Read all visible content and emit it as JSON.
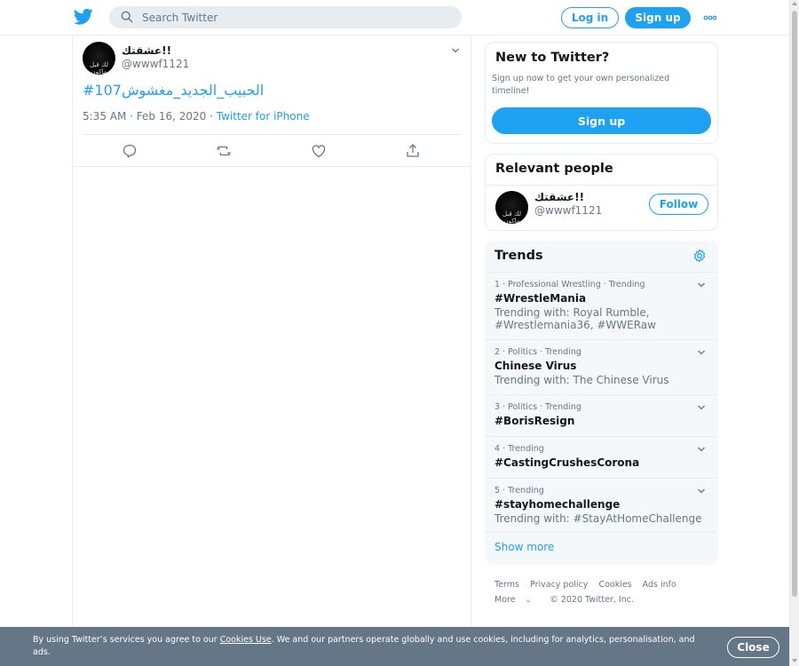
{
  "header": {
    "logo_icon": "twitter-bird-icon",
    "search_placeholder": "Search Twitter",
    "login_label": "Log in",
    "signup_label": "Sign up",
    "more_icon": "more-dots-icon"
  },
  "tweet": {
    "display_name": "عشقتك!!",
    "handle": "@wwwf1121",
    "avatar_text": "لك قبل ماكون",
    "text": "#الحبيب_الجديد_مغشوش107",
    "time": "5:35 AM · Feb 16, 2020",
    "separator": " · ",
    "source": "Twitter for iPhone",
    "actions": [
      "reply-icon",
      "retweet-icon",
      "like-icon",
      "share-icon"
    ]
  },
  "new_to_twitter": {
    "title": "New to Twitter?",
    "subtitle": "Sign up now to get your own personalized timeline!",
    "button": "Sign up"
  },
  "relevant_people": {
    "title": "Relevant people",
    "person": {
      "display_name": "عشقتك!!",
      "handle": "@wwwf1121",
      "avatar_text": "لك قبل ماكون",
      "follow_label": "Follow"
    }
  },
  "trends": {
    "title": "Trends",
    "items": [
      {
        "meta": "1 · Professional Wrestling · Trending",
        "name": "#WrestleMania",
        "with": "Trending with: Royal Rumble, #Wrestlemania36, #WWERaw"
      },
      {
        "meta": "2 · Politics · Trending",
        "name": "Chinese Virus",
        "with": "Trending with: The Chinese Virus"
      },
      {
        "meta": "3 · Politics · Trending",
        "name": "#BorisResign",
        "with": ""
      },
      {
        "meta": "4 · Trending",
        "name": "#CastingCrushesCorona",
        "with": ""
      },
      {
        "meta": "5 · Trending",
        "name": "#stayhomechallenge",
        "with": "Trending with: #StayAtHomeChallenge"
      }
    ],
    "show_more": "Show more"
  },
  "footer": {
    "links": [
      "Terms",
      "Privacy policy",
      "Cookies",
      "Ads info"
    ],
    "more": "More",
    "copyright": "© 2020 Twitter, Inc."
  },
  "cookie_banner": {
    "text_before": "By using Twitter’s services you agree to our ",
    "link": "Cookies Use",
    "text_after": ". We and our partners operate globally and use cookies, including for analytics, personalisation, and ads.",
    "close_label": "Close"
  },
  "colors": {
    "accent": "#1da1f2",
    "border": "#e6ecf0",
    "muted": "#657786",
    "banner": "#657786"
  }
}
